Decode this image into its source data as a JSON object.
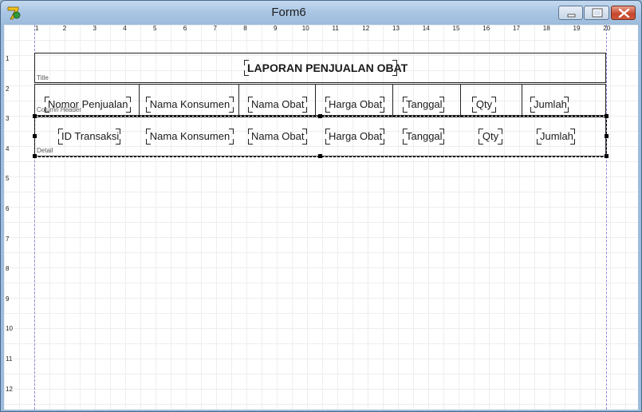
{
  "window": {
    "title": "Form6",
    "app_icon": "delphi-app-icon",
    "controls": [
      "minimize-icon",
      "maximize-icon",
      "close-icon"
    ]
  },
  "ruler": {
    "top": [
      "1",
      "2",
      "3",
      "4",
      "5",
      "6",
      "7",
      "8",
      "9",
      "10",
      "11",
      "12",
      "13",
      "14",
      "15",
      "16",
      "17",
      "18",
      "19",
      "20"
    ],
    "left": [
      "1",
      "2",
      "3",
      "4",
      "5",
      "6",
      "7",
      "8",
      "9",
      "10",
      "11",
      "12"
    ]
  },
  "bands": {
    "title_label": "Title",
    "column_header_label": "Column Header",
    "detail_label": "Detail"
  },
  "report_title": "LAPORAN PENJUALAN OBAT",
  "column_headers": [
    "Nomor Penjualan",
    "Nama Konsumen",
    "Nama Obat",
    "Harga Obat",
    "Tanggal",
    "Qty",
    "Jumlah"
  ],
  "detail_fields": [
    "ID Transaksi",
    "Nama Konsumen",
    "Nama Obat",
    "Harga Obat",
    "Tanggal",
    "Qty",
    "Jumlah"
  ]
}
